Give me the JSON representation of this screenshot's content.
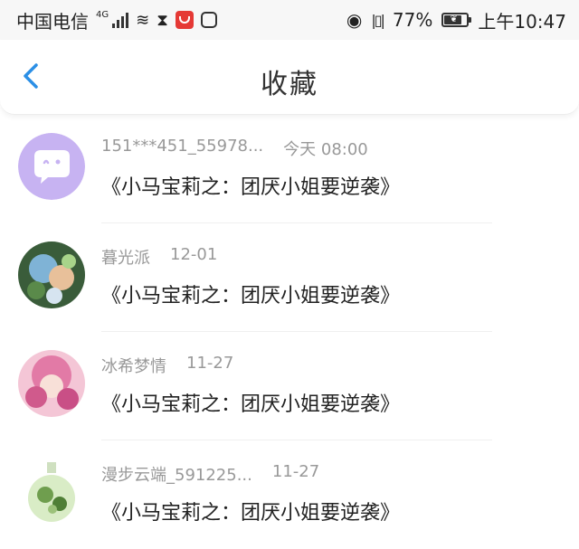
{
  "status_bar": {
    "carrier": "中国电信",
    "network": "4G",
    "battery": "77%",
    "battery_level": 0.77,
    "time": "上午10:47"
  },
  "nav": {
    "title": "收藏"
  },
  "favorites": [
    {
      "user": "151***451_55978...",
      "time": "今天 08:00",
      "book": "《小马宝莉之：团厌小姐要逆袭》"
    },
    {
      "user": "暮光派",
      "time": "12-01",
      "book": "《小马宝莉之：团厌小姐要逆袭》"
    },
    {
      "user": "冰希梦情",
      "time": "11-27",
      "book": "《小马宝莉之：团厌小姐要逆袭》"
    },
    {
      "user": "漫步云端_591225...",
      "time": "11-27",
      "book": "《小马宝莉之：团厌小姐要逆袭》"
    }
  ],
  "colors": {
    "accent": "#2b8fe6",
    "muted_text": "#999999",
    "primary_text": "#222222",
    "default_avatar": "#c7b3f2"
  }
}
